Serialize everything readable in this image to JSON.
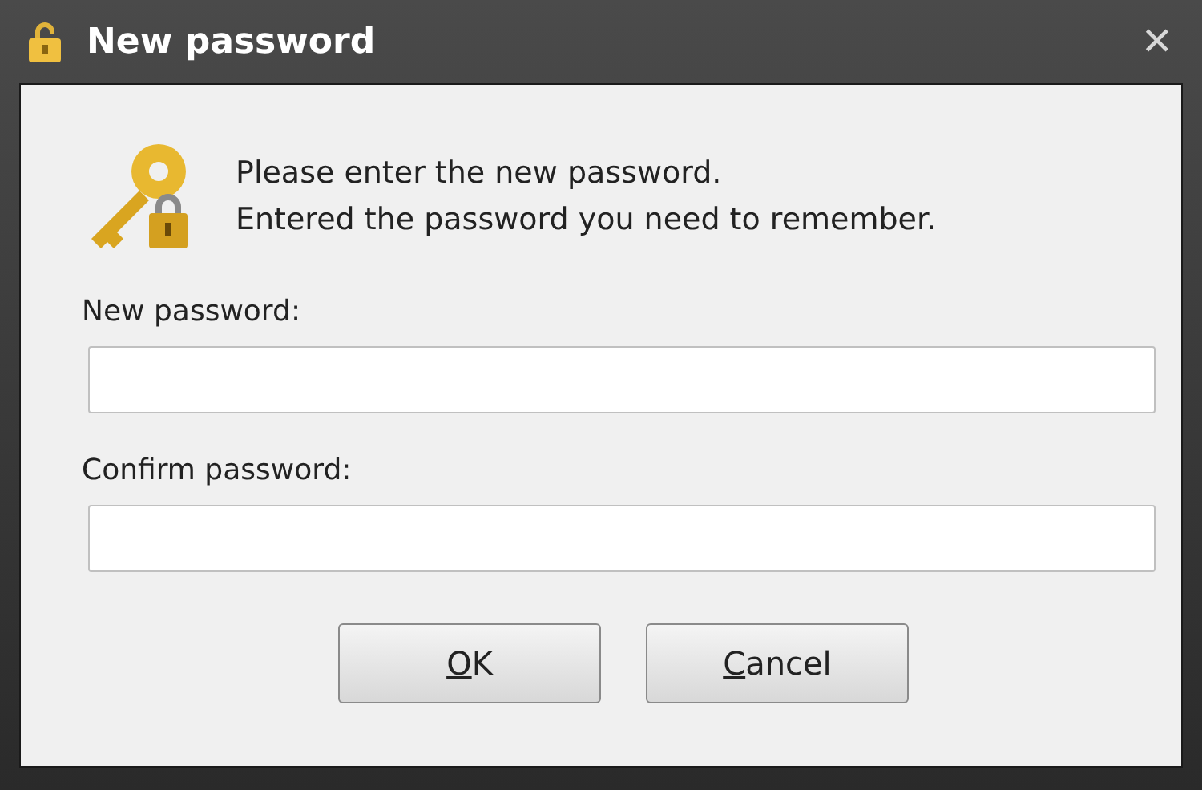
{
  "window": {
    "title": "New password",
    "close": "✕"
  },
  "message": [
    "Please enter the new password.",
    "Entered the password you need to remember."
  ],
  "fields": [
    {
      "label": "New password:"
    },
    {
      "label": "Confirm password:"
    }
  ],
  "buttons": [
    {
      "key": "O",
      "rest": "K"
    },
    {
      "key": "C",
      "rest": "ancel"
    }
  ]
}
